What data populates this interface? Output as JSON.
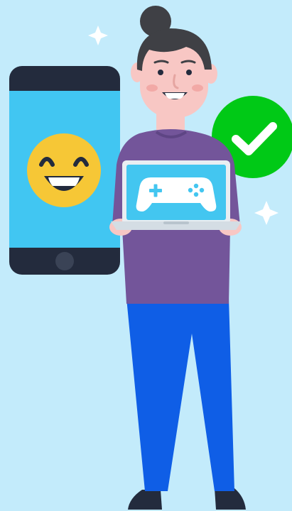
{
  "illustration": {
    "icons": [
      "sparkle-icon",
      "smartphone-icon",
      "grinning-emoji-icon",
      "checkmark-icon",
      "gamepad-icon"
    ],
    "colors": {
      "background": "#c3ebfb",
      "phone_body": "#232b3d",
      "phone_screen": "#41c6f2",
      "emoji_face": "#f6c736",
      "check_badge": "#00c916",
      "shirt": "#73559a",
      "jeans": "#0f5ee6",
      "skin": "#f8c7c4",
      "hair": "#3f4045",
      "laptop_screen": "#43c6f0",
      "laptop_frame": "#e9eef2",
      "sparkle": "#ffffff"
    }
  }
}
